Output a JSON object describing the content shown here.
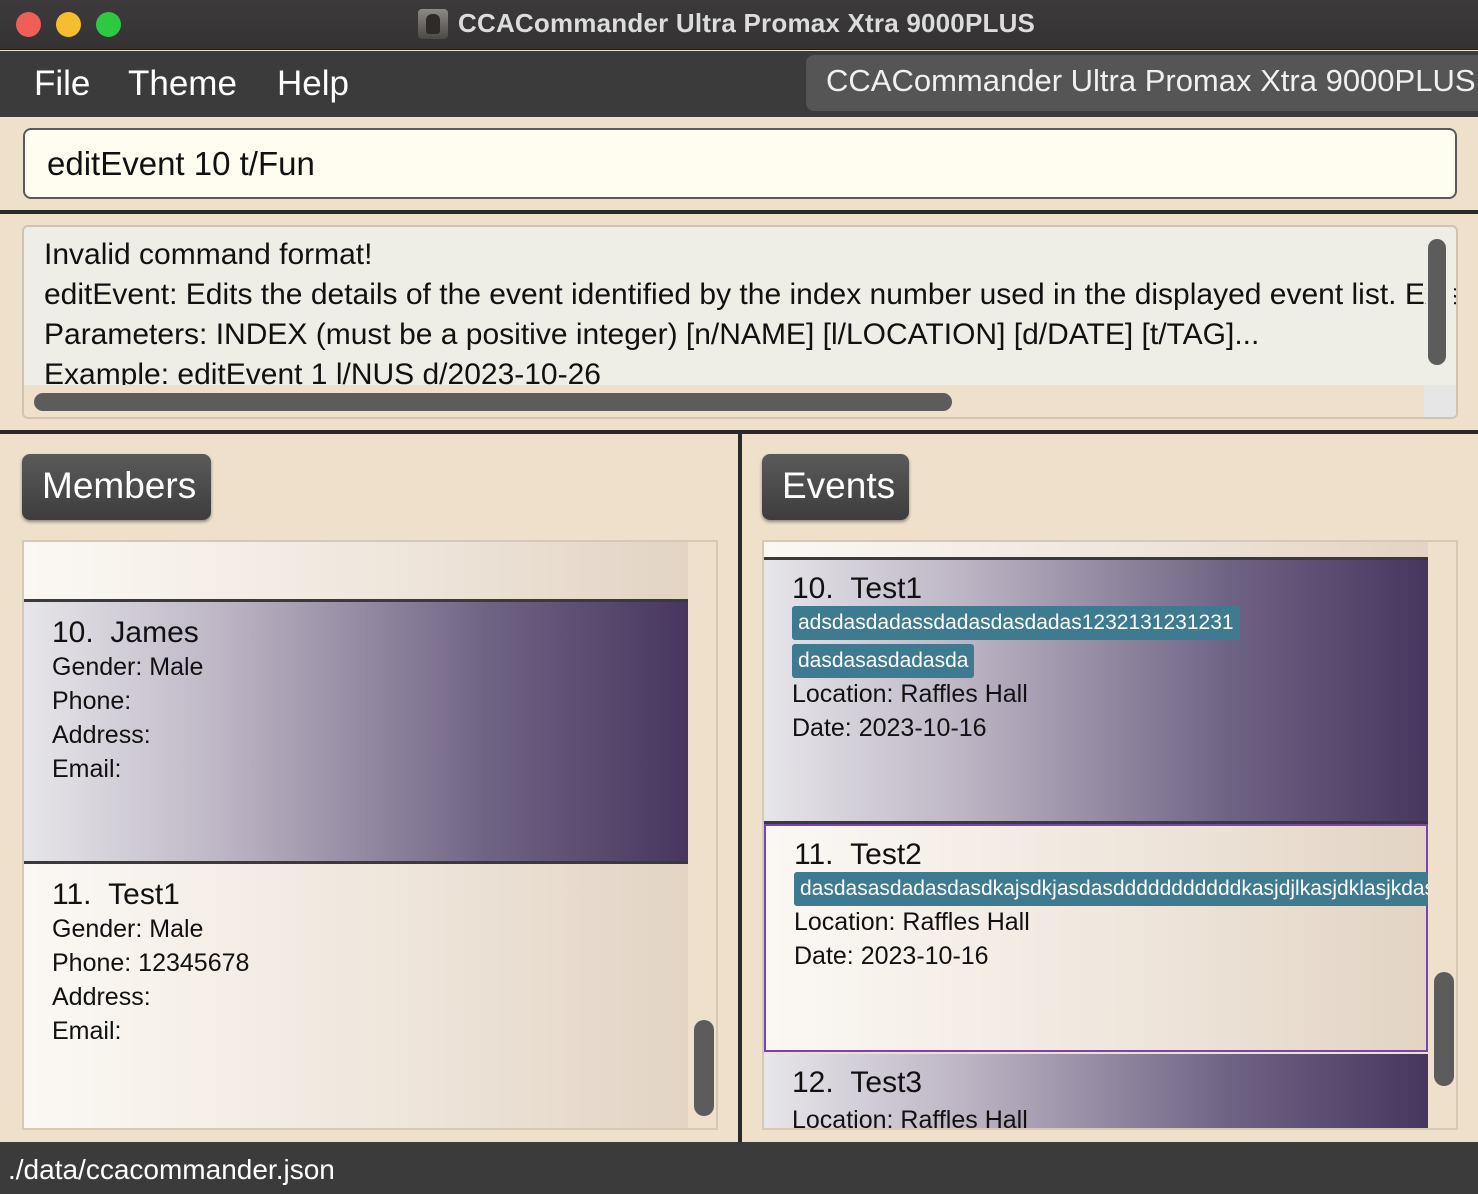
{
  "window": {
    "title": "CCACommander Ultra Promax Xtra 9000PLUS"
  },
  "menu": {
    "file": "File",
    "theme": "Theme",
    "help": "Help",
    "app_name": "CCACommander Ultra Promax Xtra 9000PLUS"
  },
  "command": {
    "value": "editEvent 10 t/Fun"
  },
  "result": {
    "lines": [
      "Invalid command format!",
      "editEvent: Edits the details of the event identified by the index number used in the displayed event list. Existing values will be overwritten by the input values.",
      "Parameters: INDEX (must be a positive integer) [n/NAME] [l/LOCATION] [d/DATE] [t/TAG]...",
      "Example: editEvent 1 l/NUS d/2023-10-26"
    ]
  },
  "members": {
    "header": "Members",
    "items": [
      {
        "index": "10.",
        "name": "James",
        "gender": "Gender: Male",
        "phone": "Phone:",
        "address": "Address:",
        "email": "Email:"
      },
      {
        "index": "11.",
        "name": "Test1",
        "gender": "Gender: Male",
        "phone": "Phone: 12345678",
        "address": "Address:",
        "email": "Email:"
      }
    ]
  },
  "events": {
    "header": "Events",
    "items": [
      {
        "index": "10.",
        "name": "Test1",
        "tags": [
          "adsdasdadassdadasdasdadas1232131231231",
          "dasdasasdadasda"
        ],
        "location": "Location: Raffles Hall",
        "date": "Date: 2023-10-16"
      },
      {
        "index": "11.",
        "name": "Test2",
        "tags": [
          "dasdasasdadasdasdkajsdkjasdasdddddddddddkasjdjlkasjdklasjkdasd"
        ],
        "location": "Location: Raffles Hall",
        "date": "Date: 2023-10-16"
      },
      {
        "index": "12.",
        "name": "Test3",
        "location": "Location: Raffles Hall"
      }
    ]
  },
  "status": {
    "path": "./data/ccacommander.json"
  }
}
